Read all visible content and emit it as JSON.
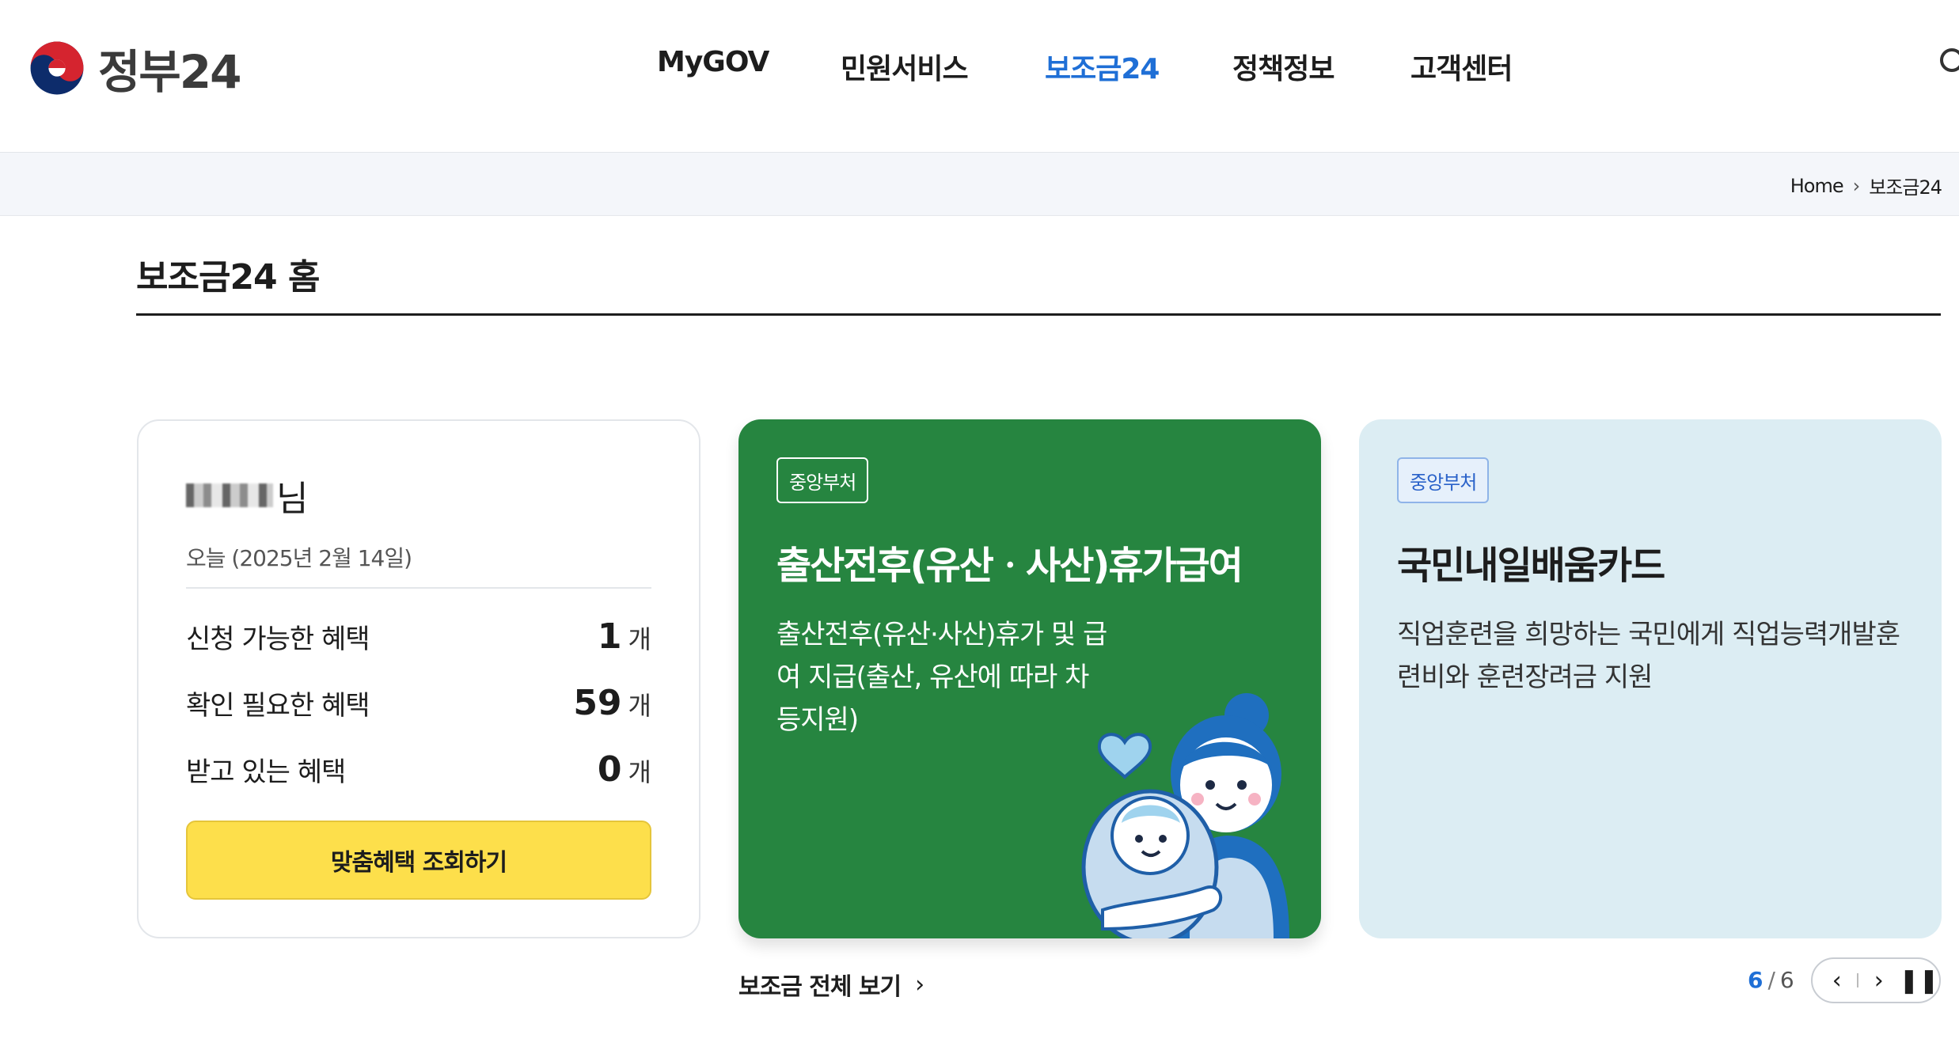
{
  "header": {
    "logo_text": "정부24",
    "nav": [
      "MyGOV",
      "민원서비스",
      "보조금24",
      "정책정보",
      "고객센터"
    ],
    "active_nav": "보조금24",
    "search_icon": "search-icon"
  },
  "breadcrumb": {
    "home": "Home",
    "current": "보조금24"
  },
  "page": {
    "title": "보조금24 홈"
  },
  "user_card": {
    "name_suffix": "님",
    "today": "오늘 (2025년 2월 14일)",
    "stats": [
      {
        "label": "신청 가능한 혜택",
        "count": "1",
        "unit": "개"
      },
      {
        "label": "확인 필요한 혜택",
        "count": "59",
        "unit": "개"
      },
      {
        "label": "받고 있는 혜택",
        "count": "0",
        "unit": "개"
      }
    ],
    "cta": "맞춤혜택 조회하기"
  },
  "benefits": [
    {
      "tag": "중앙부처",
      "title": "출산전후(유산ㆍ사산)휴가급여",
      "desc": "출산전후(유산·사산)휴가 및 급여 지급(출산, 유산에 따라 차등지원)",
      "bg": "#268540"
    },
    {
      "tag": "중앙부처",
      "title": "국민내일배움카드",
      "desc": "직업훈련을 희망하는 국민에게 직업능력개발훈련비와 훈련장려금 지원",
      "bg": "#dcedf3"
    }
  ],
  "footer": {
    "view_all": "보조금 전체 보기",
    "page_current": "6",
    "page_total": "6"
  },
  "colors": {
    "accent": "#1f6fd6",
    "cta": "#fddf4b",
    "green_card": "#268540",
    "blue_card": "#dcedf3"
  }
}
